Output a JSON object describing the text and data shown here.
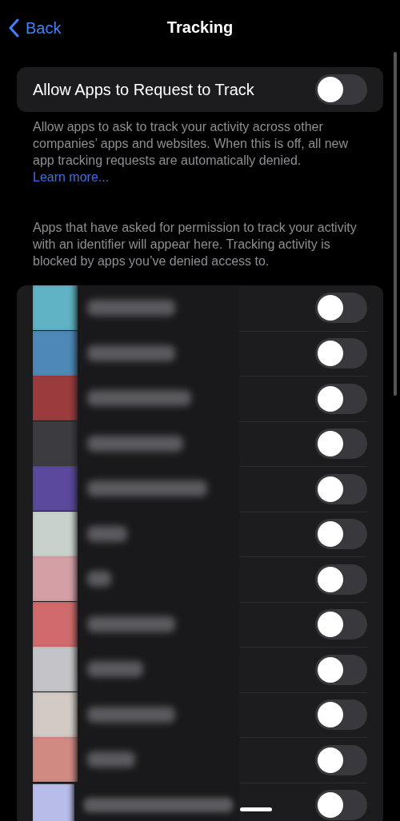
{
  "nav": {
    "back": "Back",
    "title": "Tracking"
  },
  "main_setting": {
    "label": "Allow Apps to Request to Track",
    "on": false
  },
  "description": {
    "text": "Allow apps to ask to track your activity across other companies’ apps and websites. When this is off, all new app tracking requests are automatically denied.",
    "link": "Learn more..."
  },
  "list_header": "Apps that have asked for permission to track your activity with an identifier will appear here. Tracking activity is blocked by apps you’ve denied access to.",
  "apps": [
    {
      "color": "#5fb3c4",
      "on": false
    },
    {
      "color": "#4e88b8",
      "on": false
    },
    {
      "color": "#9c3a3c",
      "on": false
    },
    {
      "color": "#3a3a40",
      "on": false
    },
    {
      "color": "#5a4a9c",
      "on": false
    },
    {
      "color": "#c8d2cc",
      "on": false
    },
    {
      "color": "#d4a0a6",
      "on": false
    },
    {
      "color": "#d06a6c",
      "on": false
    },
    {
      "color": "#c4c4c8",
      "on": false
    },
    {
      "color": "#d2cac4",
      "on": false
    },
    {
      "color": "#d08a82",
      "on": false
    },
    {
      "color": "#b8bce8",
      "on": false
    }
  ]
}
